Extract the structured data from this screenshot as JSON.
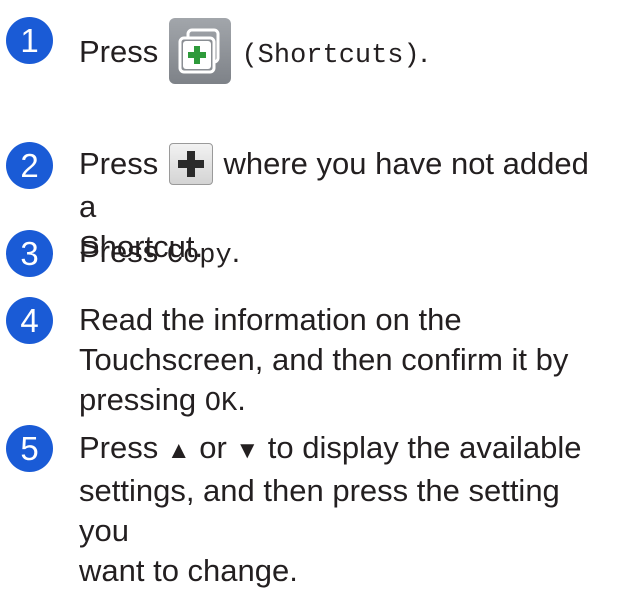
{
  "steps": [
    {
      "number": "1",
      "before": "Press ",
      "code": "(Shortcuts)",
      "after": "."
    },
    {
      "number": "2",
      "before": "Press ",
      "after": " where you have not added a",
      "line2": "Shortcut."
    },
    {
      "number": "3",
      "before": "Press ",
      "code": "Copy",
      "after": "."
    },
    {
      "number": "4",
      "line1": "Read the information on the",
      "line2": "Touchscreen, and then confirm it by",
      "line3_before": "pressing ",
      "code": "OK",
      "line3_after": "."
    },
    {
      "number": "5",
      "before": "Press ",
      "up": "▲",
      "middle": " or ",
      "down": "▼",
      "after": " to display the available",
      "line2": "settings, and then press the setting you",
      "line3": "want to change."
    }
  ],
  "colors": {
    "badge": "#1a5bd6",
    "shortcut_icon_bg": "#8a8e93",
    "plus_icon_green": "#2e9a3a"
  },
  "icons": [
    "shortcuts-icon",
    "add-shortcut-plus-icon"
  ]
}
